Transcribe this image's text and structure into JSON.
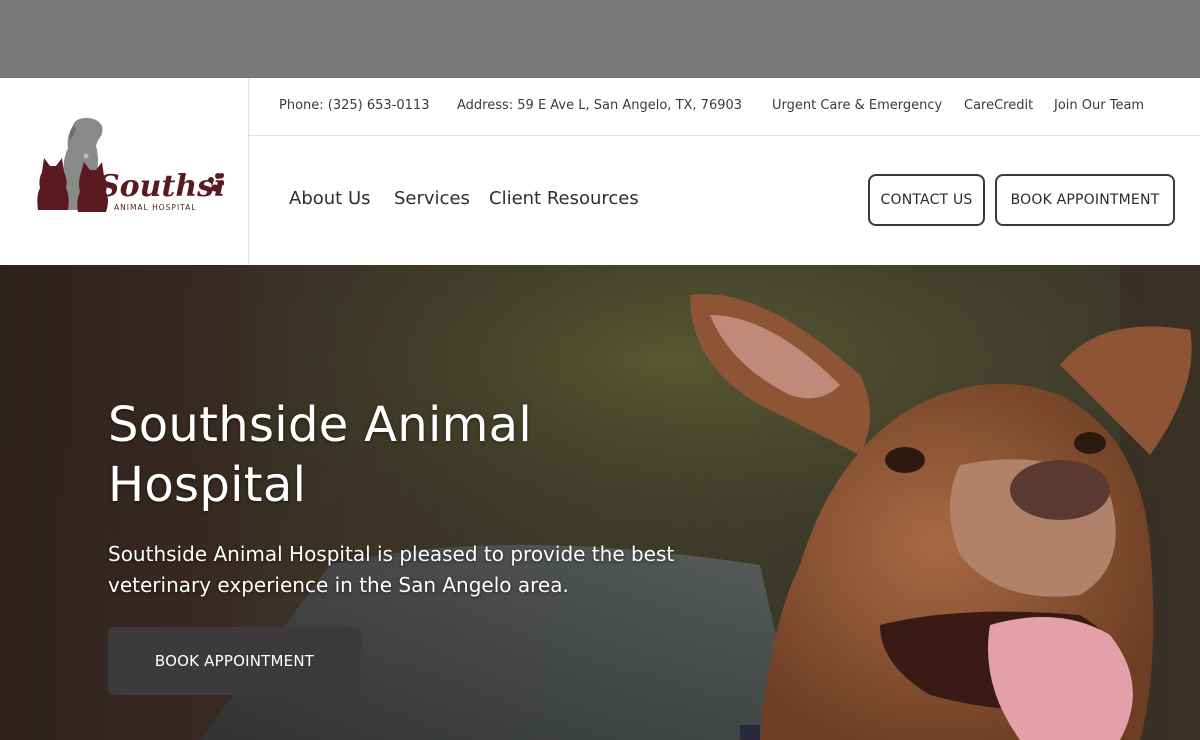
{
  "brand": {
    "name": "Southside",
    "tagline": "ANIMAL HOSPITAL",
    "colors": {
      "logo_maroon": "#5a1a1f",
      "logo_gray": "#8a8a8a"
    }
  },
  "utility_bar": {
    "phone": "Phone: (325) 653-0113",
    "address": "Address: 59 E Ave L, San Angelo, TX, 76903",
    "urgent": "Urgent Care & Emergency",
    "carecredit": "CareCredit",
    "join": "Join Our Team"
  },
  "nav": {
    "about": "About Us",
    "services": "Services",
    "resources": "Client Resources"
  },
  "header_buttons": {
    "contact": "CONTACT US",
    "book": "BOOK APPOINTMENT"
  },
  "hero": {
    "title_line1": "Southside Animal",
    "title_line2": "Hospital",
    "subtitle": "Southside Animal Hospital is pleased to provide the best veterinary experience in the San Angelo area.",
    "button": "BOOK APPOINTMENT",
    "image": "dog-photo"
  }
}
